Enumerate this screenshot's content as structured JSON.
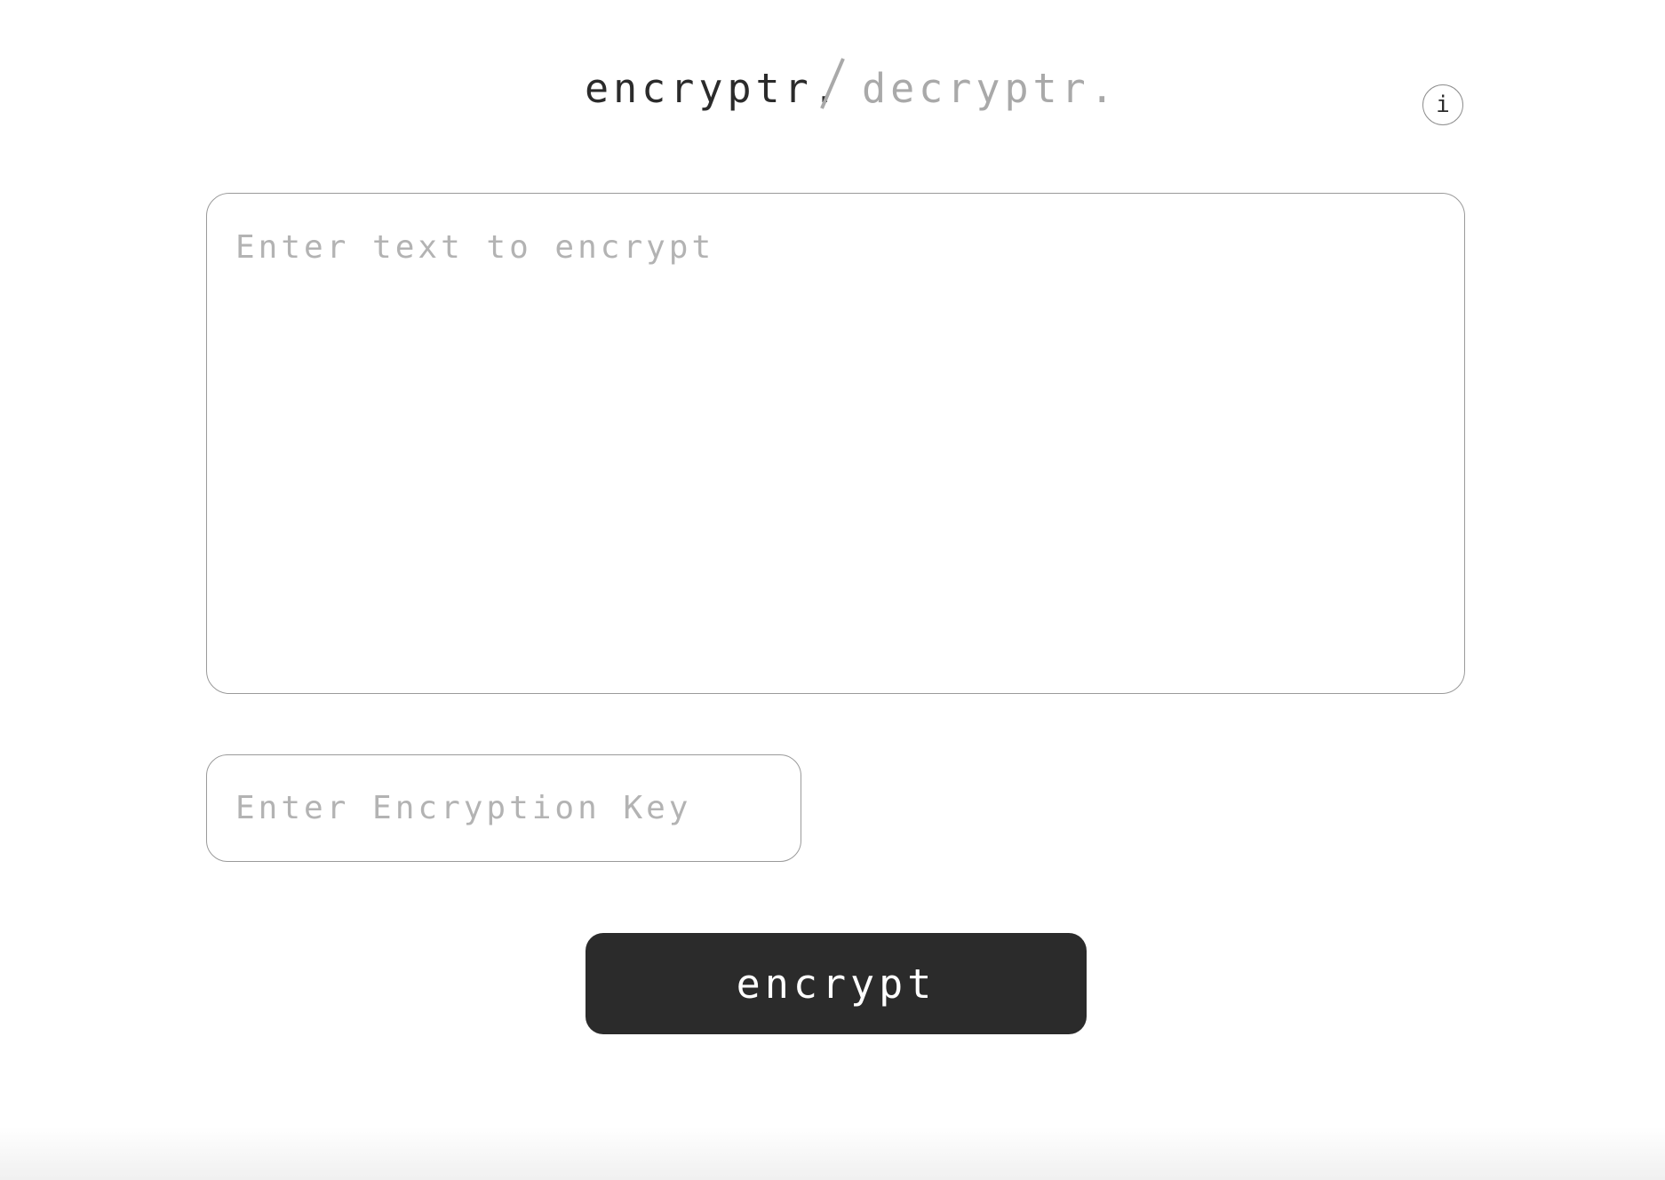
{
  "header": {
    "tabs": [
      {
        "label": "encryptr.",
        "active": true
      },
      {
        "label": "decryptr.",
        "active": false
      }
    ],
    "separator": "/",
    "info_label": "i"
  },
  "form": {
    "text_input": {
      "placeholder": "Enter text to encrypt",
      "value": ""
    },
    "key_input": {
      "placeholder": "Enter Encryption Key",
      "value": ""
    },
    "submit_label": "encrypt"
  },
  "colors": {
    "primary": "#2b2b2b",
    "inactive": "#a9a9a9",
    "placeholder": "#b3b3b3",
    "border": "#9a9a9a",
    "background": "#ffffff"
  }
}
